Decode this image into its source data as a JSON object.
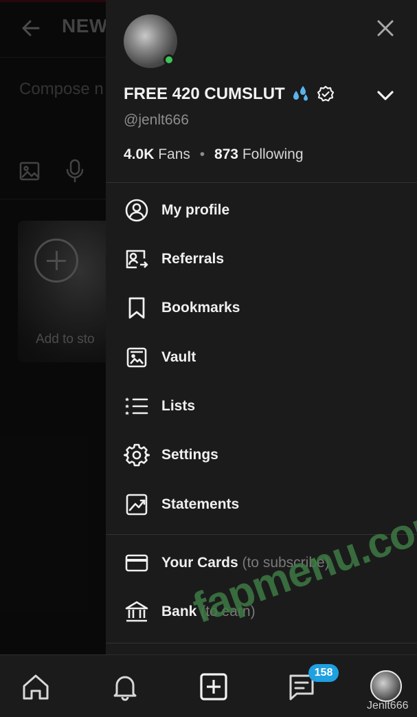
{
  "background": {
    "header_title": "NEW",
    "compose_placeholder": "Compose n",
    "story_label": "Add to sto"
  },
  "drawer": {
    "display_name": "FREE 420 CUMSLUT",
    "handle": "@jenlt666",
    "fans_count": "4.0K",
    "fans_label": "Fans",
    "following_count": "873",
    "following_label": "Following",
    "online_status_color": "#3fc55a",
    "menu": [
      {
        "label": "My profile",
        "icon": "user-circle-icon"
      },
      {
        "label": "Referrals",
        "icon": "referrals-icon"
      },
      {
        "label": "Bookmarks",
        "icon": "bookmark-icon"
      },
      {
        "label": "Vault",
        "icon": "vault-icon"
      },
      {
        "label": "Lists",
        "icon": "lists-icon"
      },
      {
        "label": "Settings",
        "icon": "gear-icon"
      },
      {
        "label": "Statements",
        "icon": "chart-icon"
      }
    ],
    "payments": [
      {
        "label": "Your Cards",
        "sub": "(to subscribe)",
        "icon": "card-icon"
      },
      {
        "label": "Bank",
        "sub": "(to earn)",
        "icon": "bank-icon"
      }
    ]
  },
  "bottom_nav": {
    "messages_badge": "158",
    "avatar_label": "Jenlt666"
  },
  "watermark": "fapmenu.com",
  "colors": {
    "drawer_bg": "#1b1b1c",
    "badge": "#1fa0e0",
    "watermark": "#3e7a43"
  }
}
